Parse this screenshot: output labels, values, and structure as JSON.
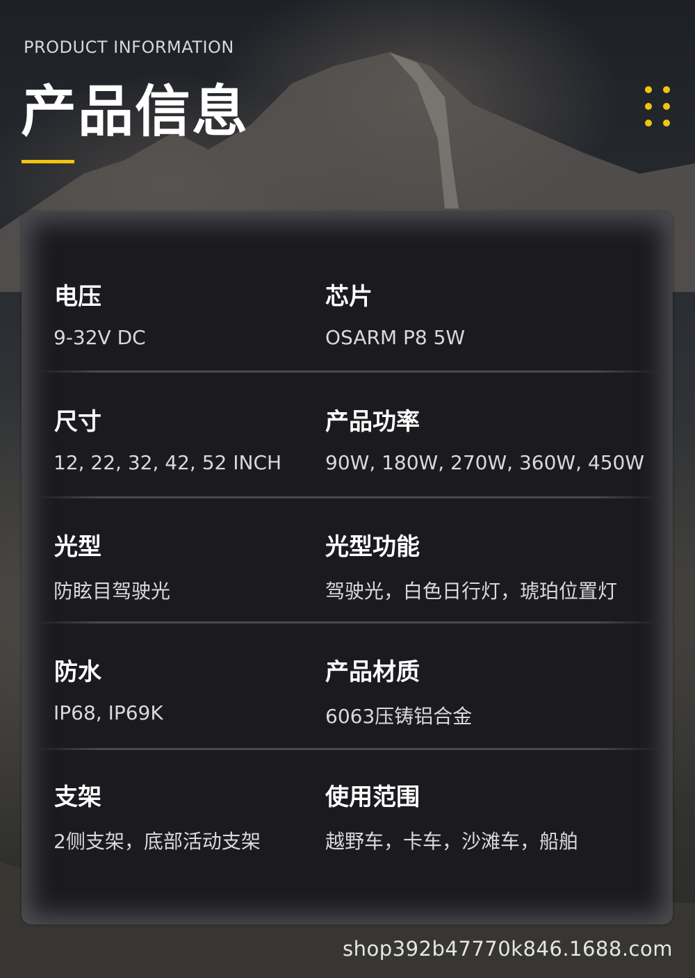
{
  "header": {
    "subtitle_en": "PRODUCT INFORMATION",
    "title_cn": "产品信息",
    "accent_color": "#f2c40f",
    "decor_icon": "dot-grid-icon"
  },
  "specs": [
    {
      "left": {
        "label": "电压",
        "value": "9-32V DC"
      },
      "right": {
        "label": "芯片",
        "value": "OSARM P8 5W"
      }
    },
    {
      "left": {
        "label": "尺寸",
        "value": "12, 22, 32, 42, 52 INCH"
      },
      "right": {
        "label": "产品功率",
        "value": "90W, 180W, 270W, 360W, 450W"
      }
    },
    {
      "left": {
        "label": "光型",
        "value": "防眩目驾驶光"
      },
      "right": {
        "label": "光型功能",
        "value": "驾驶光，白色日行灯，琥珀位置灯"
      }
    },
    {
      "left": {
        "label": "防水",
        "value": "IP68, IP69K"
      },
      "right": {
        "label": "产品材质",
        "value": "6063压铸铝合金"
      }
    },
    {
      "left": {
        "label": "支架",
        "value": "2侧支架，底部活动支架"
      },
      "right": {
        "label": "使用范围",
        "value": "越野车，卡车，沙滩车，船舶"
      }
    }
  ],
  "watermark": "shop392b47770k846.1688.com"
}
